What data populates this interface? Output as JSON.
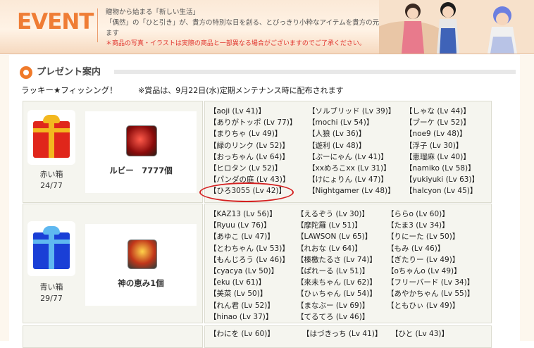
{
  "banner": {
    "logo": "EVENT",
    "line1": "贈物から始まる「新しい生活」",
    "line2": "「偶然」の「ひと引き」が、貴方の特別な日を創る、とびっきり小粋なアイテムを貴方の元に届けます",
    "warning": "＊商品の写真・イラストは実際の商品と一部異なる場合がございますのでご了承ください。"
  },
  "section": {
    "title": "プレゼント案内",
    "subtitle": "ラッキー★フィッシング！",
    "note": "※賞品は、9月22日(水)定期メンテナンス時に配布されます"
  },
  "prizes": [
    {
      "box_name": "赤い箱",
      "count": "24/77",
      "item": "ルビー　7777個",
      "box_color": "#e0261b",
      "ribbon_color": "#f3b81f",
      "columns": [
        [
          "【aoji (Lv 41)】",
          "【ありがトッポ (Lv 77)】",
          "【まりちゃ (Lv 49)】",
          "【緑のリンク (Lv 52)】",
          "【おっちゃん (Lv 64)】",
          "【ヒロタン (Lv 52)】",
          "【パンダの庭 (Lv 43)】",
          "【ひろ3055 (Lv 42)】"
        ],
        [
          "【ソルブリッド (Lv 39)】",
          "【mochi (Lv 54)】",
          "【人狼 (Lv 36)】",
          "【遊利 (Lv 48)】",
          "【ぶーにゃん (Lv 41)】",
          "【xxめろこxx (Lv 31)】",
          "【けにょりん (Lv 47)】",
          "【Nightgamer (Lv 48)】"
        ],
        [
          "【しゃな (Lv 44)】",
          "【ブーケ (Lv 52)】",
          "【noe9 (Lv 48)】",
          "【浮子 (Lv 30)】",
          "【恵瑠麻 (Lv 40)】",
          "【namiko (Lv 58)】",
          "【yukiyuki (Lv 63)】",
          "【halcyon (Lv 45)】"
        ]
      ]
    },
    {
      "box_name": "青い箱",
      "count": "29/77",
      "item": "神の恵み1個",
      "box_color": "#1a3fd6",
      "ribbon_color": "#5fb8f0",
      "columns": [
        [
          "【KAZ13 (Lv 56)】",
          "【Ryuu (Lv 76)】",
          "【あゆこ (Lv 47)】",
          "【とわちゃん (Lv 53)】",
          "【もんじろう (Lv 46)】",
          "【cyacya (Lv 50)】",
          "【eku (Lv 61)】",
          "【美菜 (Lv 50)】",
          "【れん君 (Lv 52)】",
          "【hinao (Lv 37)】"
        ],
        [
          "【えるぞう (Lv 30)】",
          "【摩陀羅 (Lv 51)】",
          "【LAWSON (Lv 65)】",
          "【れおな (Lv 64)】",
          "【榛檄たるさ (Lv 74)】",
          "【ぱれーる (Lv 51)】",
          "【來未ちゃん (Lv 62)】",
          "【ひぃちゃん (Lv 54)】",
          "【まなぶー (Lv 69)】",
          "【てるてろ (Lv 46)】"
        ],
        [
          "【ららo (Lv 60)】",
          "【たま3 (Lv 34)】",
          "【りにーた (Lv 50)】",
          "【もみ (Lv 46)】",
          "【ぎたりー (Lv 49)】",
          "【oちゃんo (Lv 49)】",
          "【フリーバード (Lv 34)】",
          "【あやかちゃん (Lv 55)】",
          "【ともひぃ (Lv 49)】"
        ]
      ]
    },
    {
      "columns": [
        [
          "【わにを (Lv 60)】"
        ],
        [
          "【はづきっち (Lv 41)】"
        ],
        [
          "【ひと (Lv 43)】"
        ]
      ]
    }
  ]
}
